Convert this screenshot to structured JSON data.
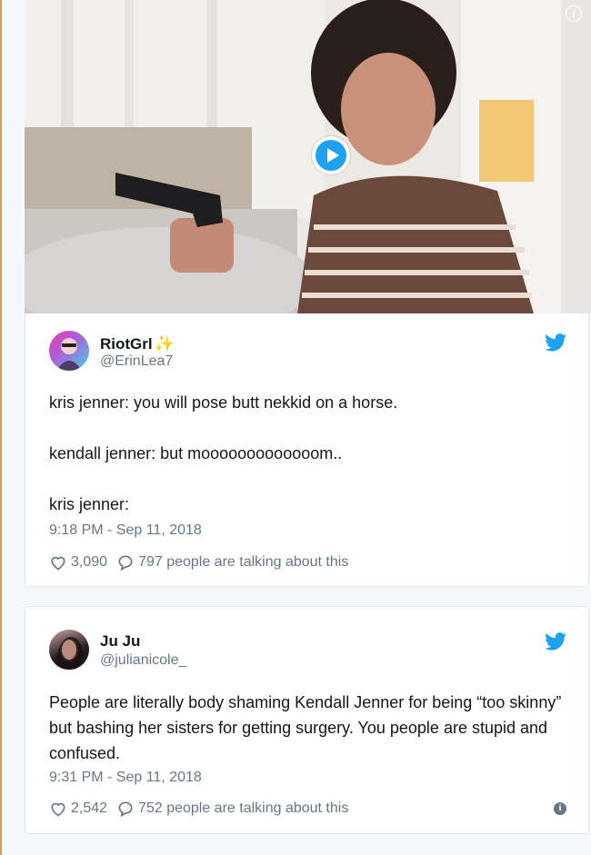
{
  "media": {
    "info_icon": "info-icon",
    "play_icon": "play-icon"
  },
  "tweets": [
    {
      "name": "RiotGrl",
      "name_emoji": "✨",
      "handle": "@ErinLea7",
      "text_lines": [
        "kris jenner: you will pose butt nekkid on a horse.",
        "kendall jenner: but mooooooooooooom..",
        "kris jenner:"
      ],
      "timestamp": "9:18 PM - Sep 11, 2018",
      "likes": "3,090",
      "talking": "797 people are talking about this"
    },
    {
      "name": "Ju Ju",
      "handle": "@julianicole_",
      "text": "People are literally body shaming Kendall Jenner for being “too skinny” but bashing her sisters for getting surgery. You people are stupid and confused.",
      "timestamp": "9:31 PM - Sep 11, 2018",
      "likes": "2,542",
      "talking": "752 people are talking about this"
    }
  ],
  "colors": {
    "twitter_blue": "#1da1f2",
    "secondary_text": "#657786",
    "border": "#e1e8ed"
  }
}
